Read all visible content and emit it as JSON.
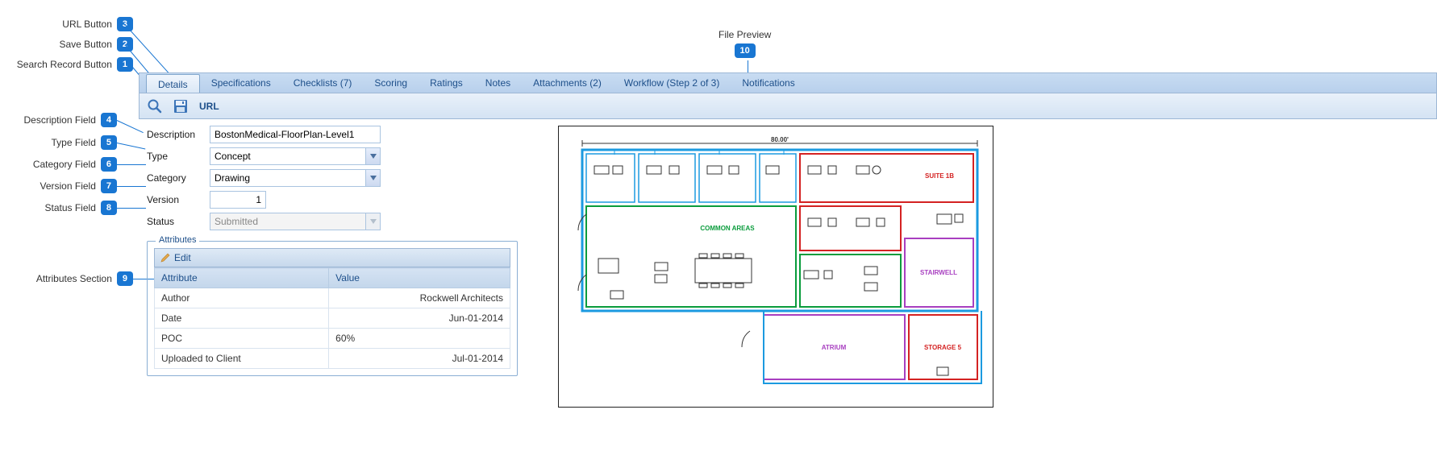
{
  "callouts": {
    "c1": "Search Record Button",
    "c2": "Save Button",
    "c3": "URL Button",
    "c4": "Description Field",
    "c5": "Type Field",
    "c6": "Category Field",
    "c7": "Version Field",
    "c8": "Status Field",
    "c9": "Attributes Section",
    "c10": "File Preview",
    "n1": "1",
    "n2": "2",
    "n3": "3",
    "n4": "4",
    "n5": "5",
    "n6": "6",
    "n7": "7",
    "n8": "8",
    "n9": "9",
    "n10": "10"
  },
  "tabs": {
    "details": "Details",
    "specifications": "Specifications",
    "checklists": "Checklists (7)",
    "scoring": "Scoring",
    "ratings": "Ratings",
    "notes": "Notes",
    "attachments": "Attachments (2)",
    "workflow": "Workflow (Step 2 of 3)",
    "notifications": "Notifications"
  },
  "toolbar": {
    "url_label": "URL"
  },
  "fields": {
    "description_label": "Description",
    "description_value": "BostonMedical-FloorPlan-Level1",
    "type_label": "Type",
    "type_value": "Concept",
    "category_label": "Category",
    "category_value": "Drawing",
    "version_label": "Version",
    "version_value": "1",
    "status_label": "Status",
    "status_value": "Submitted"
  },
  "attributes": {
    "legend": "Attributes",
    "edit_label": "Edit",
    "col_attribute": "Attribute",
    "col_value": "Value",
    "rows": [
      {
        "attr": "Author",
        "val": "Rockwell Architects"
      },
      {
        "attr": "Date",
        "val": "Jun-01-2014"
      },
      {
        "attr": "POC",
        "val": "60%"
      },
      {
        "attr": "Uploaded to Client",
        "val": "Jul-01-2014"
      }
    ]
  },
  "floorplan": {
    "dim_label": "80.00'",
    "common": "COMMON AREAS",
    "suite": "SUITE 1B",
    "stairwell": "STAIRWELL",
    "atrium": "ATRIUM",
    "storage": "STORAGE 5"
  }
}
